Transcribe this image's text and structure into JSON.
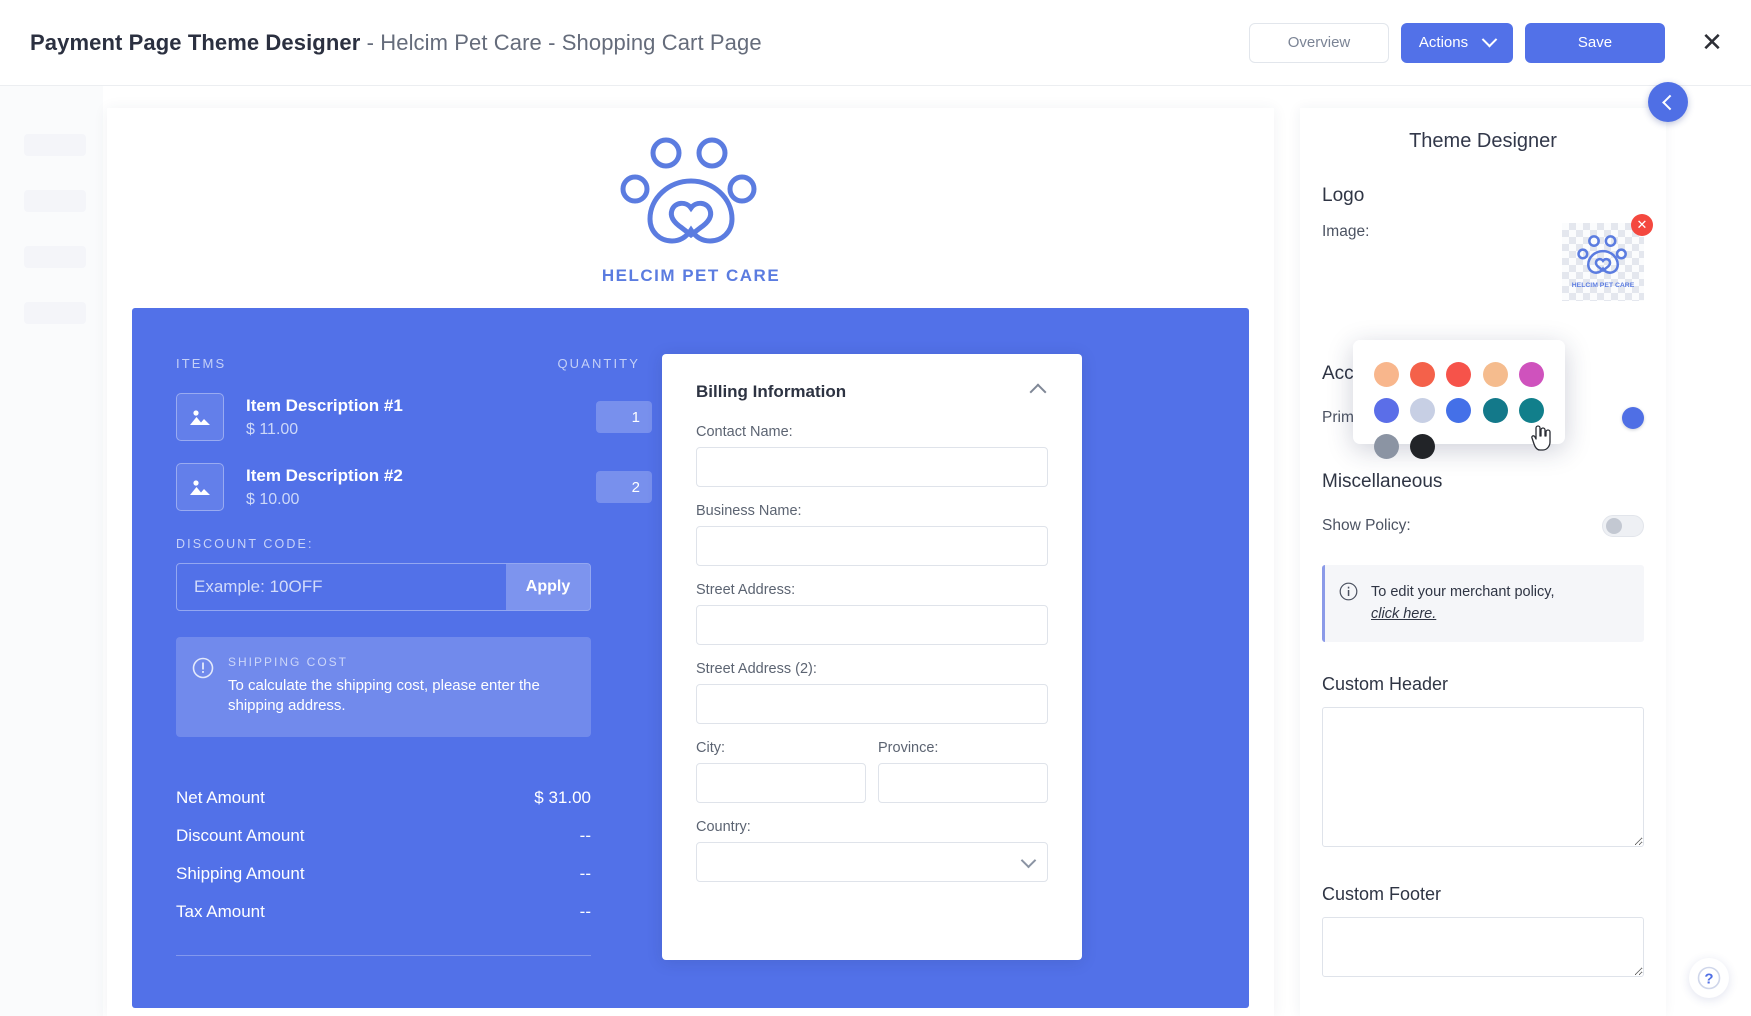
{
  "header": {
    "title_strong": "Payment Page Theme Designer",
    "title_sub": " - Helcim Pet Care - Shopping Cart Page",
    "overview_label": "Overview",
    "actions_label": "Actions",
    "save_label": "Save",
    "close_icon": "close-icon"
  },
  "preview": {
    "logo_text": "HELCIM PET CARE",
    "cart": {
      "col_items": "ITEMS",
      "col_quantity": "QUANTITY",
      "items": [
        {
          "name": "Item Description #1",
          "price": "$ 11.00",
          "qty": "1"
        },
        {
          "name": "Item Description #2",
          "price": "$ 10.00",
          "qty": "2"
        }
      ],
      "discount_label": "DISCOUNT CODE:",
      "discount_placeholder": "Example: 10OFF",
      "discount_value": "",
      "apply_label": "Apply",
      "shipping_title": "SHIPPING COST",
      "shipping_body": "To calculate the shipping cost, please enter the shipping address.",
      "totals": [
        {
          "label": "Net Amount",
          "value": "$ 31.00"
        },
        {
          "label": "Discount Amount",
          "value": "--"
        },
        {
          "label": "Shipping Amount",
          "value": "--"
        },
        {
          "label": "Tax Amount",
          "value": "--"
        }
      ]
    },
    "billing": {
      "title": "Billing Information",
      "collapse_icon": "chevron-up-icon",
      "fields": [
        {
          "label": "Contact Name:",
          "value": ""
        },
        {
          "label": "Business Name:",
          "value": ""
        },
        {
          "label": "Street Address:",
          "value": ""
        },
        {
          "label": "Street Address (2):",
          "value": ""
        }
      ],
      "city_label": "City:",
      "city_value": "",
      "province_label": "Province:",
      "province_value": "",
      "country_label": "Country:",
      "country_value": ""
    }
  },
  "designer": {
    "title": "Theme Designer",
    "logo_section": "Logo",
    "image_label": "Image:",
    "remove_image_icon": "delete-circle-icon",
    "accent_section": "Acc",
    "primary_label": "Prim",
    "primary_color": "#4f6fe5",
    "misc_section": "Miscellaneous",
    "show_policy_label": "Show Policy:",
    "show_policy_on": false,
    "info_icon": "info-circle-icon",
    "info_text": "To edit your merchant policy,",
    "info_link": "click here.",
    "custom_header_label": "Custom Header",
    "custom_header_value": "",
    "custom_footer_label": "Custom Footer",
    "custom_footer_value": ""
  },
  "color_picker": {
    "swatches": [
      "#f8b68c",
      "#f4614a",
      "#f6534a",
      "#f5bc8e",
      "#cf52bd",
      "#5b6ee8",
      "#c7cfe4",
      "#4470e8",
      "#13798a",
      "#117f8b",
      "#8b94a3",
      "#222428"
    ],
    "selected_index": 9
  },
  "controls": {
    "collapse_icon": "chevron-left-icon",
    "help_icon": "question-circle-icon"
  }
}
